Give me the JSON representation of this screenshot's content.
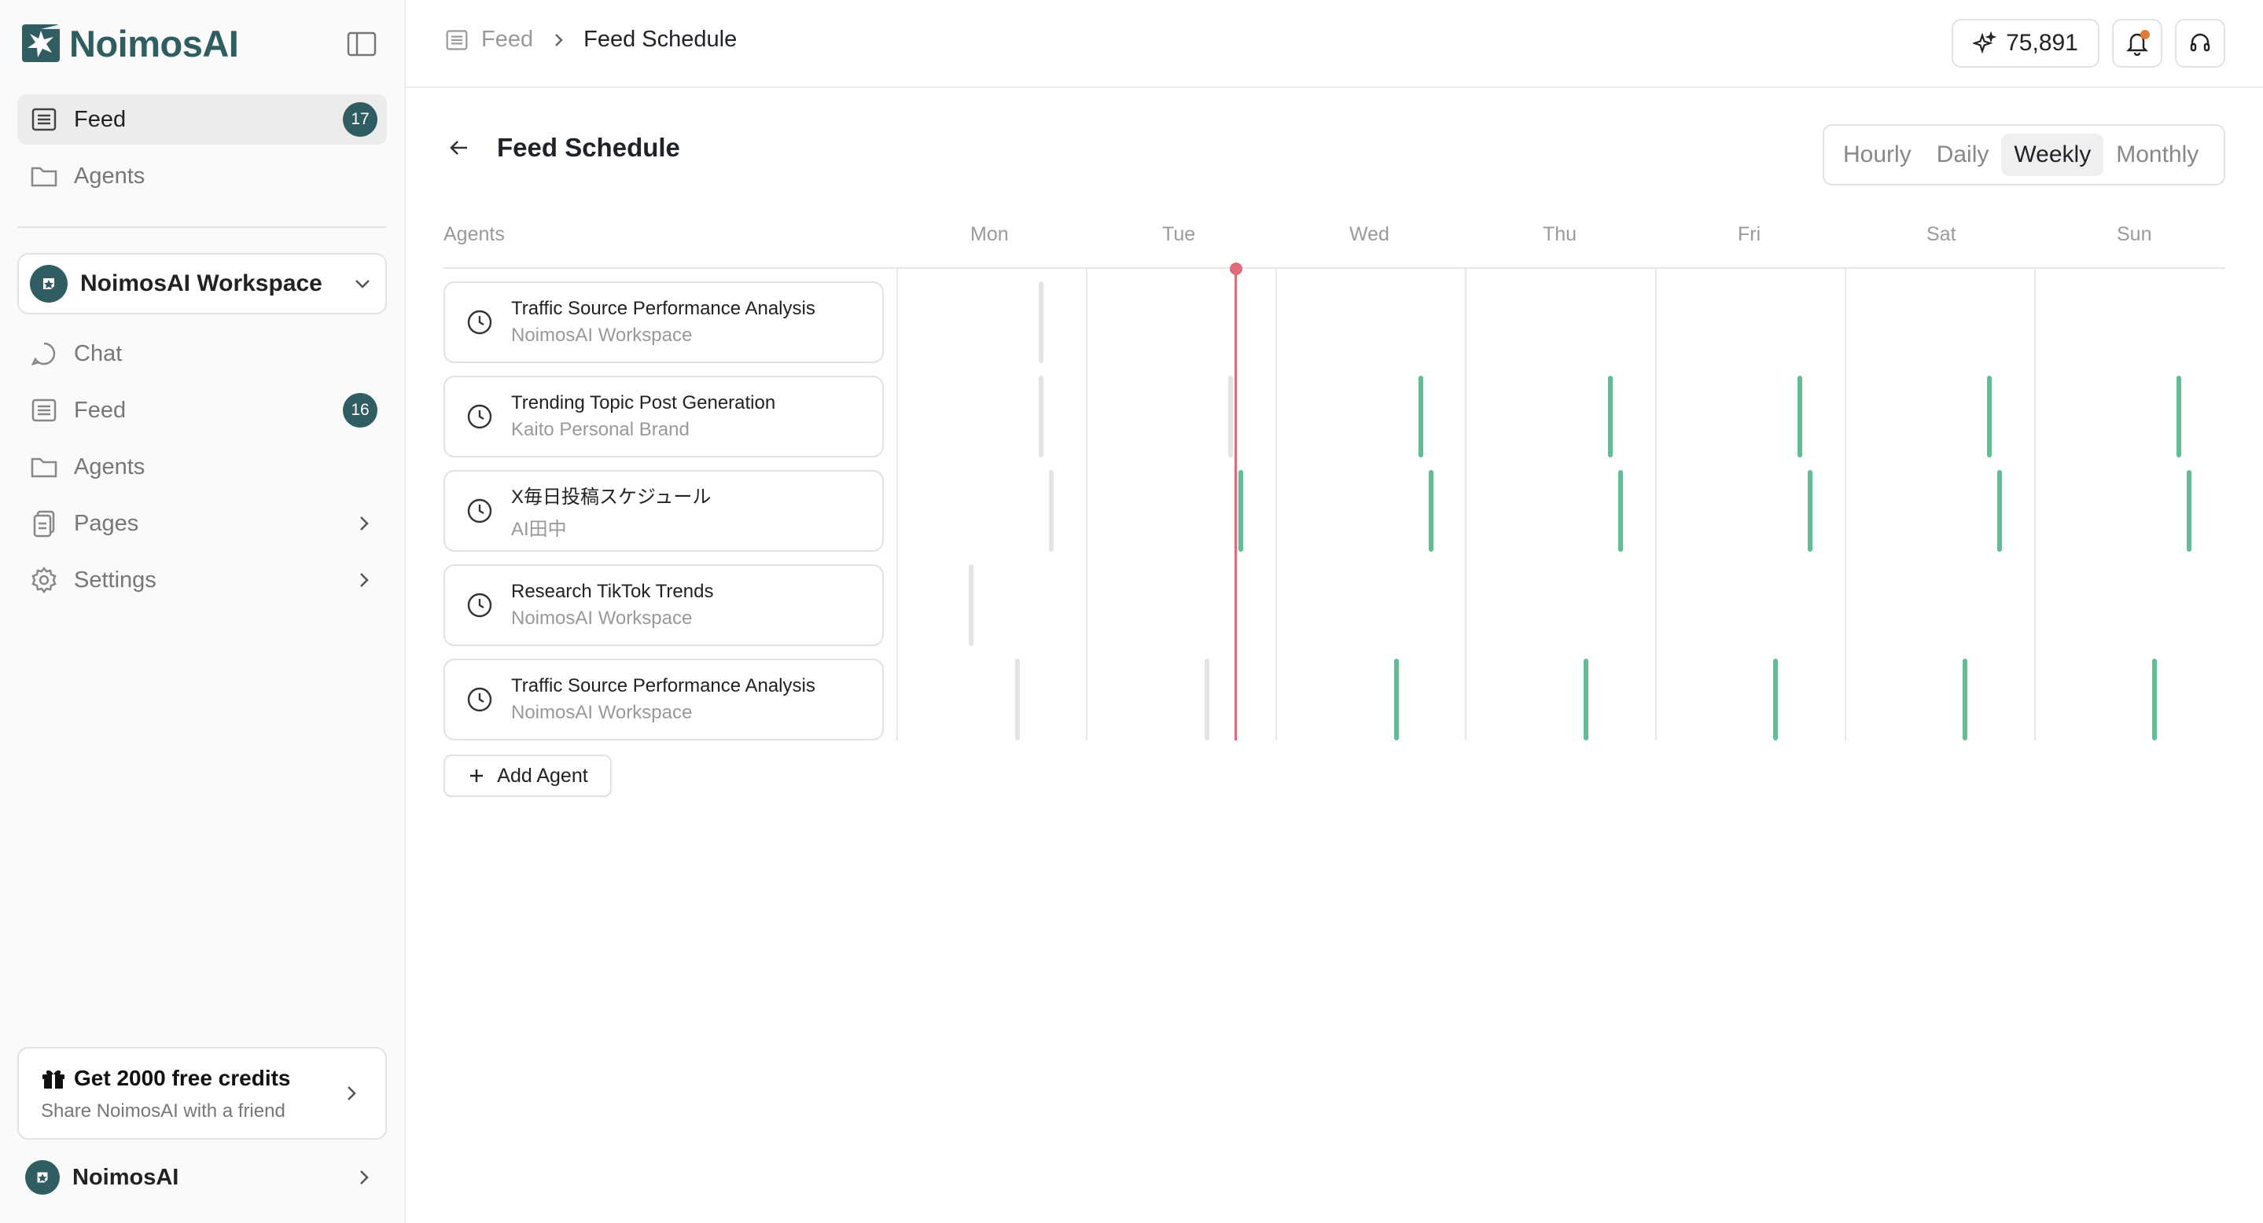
{
  "brand": {
    "name": "NoimosAI"
  },
  "sidebar": {
    "top_items": [
      {
        "label": "Feed",
        "badge": "17",
        "active": true
      },
      {
        "label": "Agents"
      }
    ],
    "workspace": {
      "name": "NoimosAI Workspace"
    },
    "items": [
      {
        "label": "Chat"
      },
      {
        "label": "Feed",
        "badge": "16"
      },
      {
        "label": "Agents"
      },
      {
        "label": "Pages"
      },
      {
        "label": "Settings"
      }
    ],
    "promo": {
      "title": "Get 2000 free credits",
      "subtitle": "Share NoimosAI with a friend"
    },
    "user": {
      "name": "NoimosAI"
    }
  },
  "header": {
    "breadcrumb": {
      "parent": "Feed",
      "current": "Feed Schedule"
    },
    "credits": "75,891"
  },
  "page": {
    "title": "Feed Schedule",
    "view_options": [
      "Hourly",
      "Daily",
      "Weekly",
      "Monthly"
    ],
    "selected_view": "Weekly"
  },
  "schedule": {
    "agents_header": "Agents",
    "days": [
      "Mon",
      "Tue",
      "Wed",
      "Thu",
      "Fri",
      "Sat",
      "Sun"
    ],
    "agents": [
      {
        "title": "Traffic Source Performance Analysis",
        "workspace": "NoimosAI Workspace"
      },
      {
        "title": "Trending Topic Post Generation",
        "workspace": "Kaito Personal Brand"
      },
      {
        "title": "X毎日投稿スケジュール",
        "workspace": "AI田中"
      },
      {
        "title": "Research TikTok Trends",
        "workspace": "NoimosAI Workspace"
      },
      {
        "title": "Traffic Source Performance Analysis",
        "workspace": "NoimosAI Workspace"
      }
    ],
    "add_agent_label": "Add Agent"
  },
  "colors": {
    "accent": "#2f5d62",
    "run": "#5fbf94",
    "past": "#e4e4e4",
    "now": "#e06a77"
  }
}
